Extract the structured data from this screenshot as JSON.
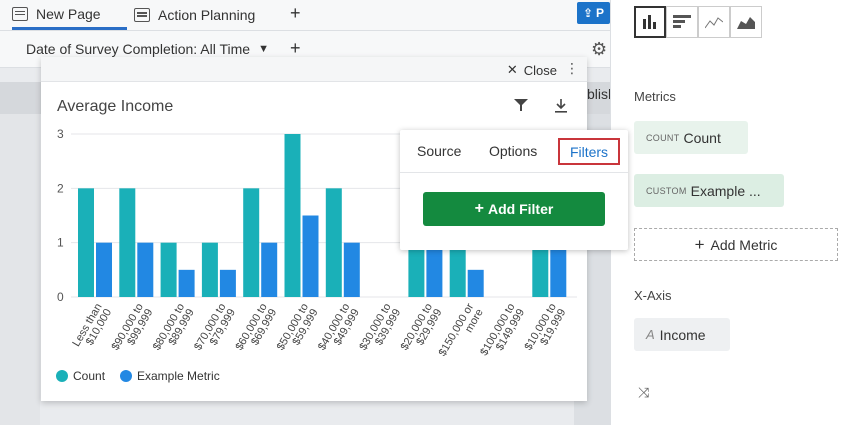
{
  "tabs": [
    {
      "label": "New Page",
      "active": true
    },
    {
      "label": "Action Planning",
      "active": false
    }
  ],
  "publish_label": "P",
  "filter_label": "Date of Survey Completion: All Time",
  "behind_text": "blish",
  "right_panel": {
    "metrics_label": "Metrics",
    "metrics": [
      {
        "prefix": "COUNT",
        "name": "Count"
      },
      {
        "prefix": "CUSTOM",
        "name": "Example ..."
      }
    ],
    "add_metric_label": "Add Metric",
    "xaxis_label": "X-Axis",
    "xaxis_value": "Income"
  },
  "modal": {
    "close_label": "Close",
    "title": "Average Income"
  },
  "popover": {
    "tabs": [
      "Source",
      "Options",
      "Filters"
    ],
    "active_tab": "Filters",
    "add_filter_label": "Add Filter"
  },
  "colors": {
    "count": "#1ab0b8",
    "example_metric": "#2288e3",
    "accent": "#1c73c9",
    "green": "#148a3f",
    "highlight": "#c9353b"
  },
  "chart_data": {
    "type": "bar",
    "title": "Average Income",
    "ylim": [
      0,
      3
    ],
    "yticks": [
      0,
      1,
      2,
      3
    ],
    "legend_position": "bottom-left",
    "categories": [
      "Less than $10,000",
      "$90,000 to $99,999",
      "$80,000 to $89,999",
      "$70,000 to $79,999",
      "$60,000 to $69,999",
      "$50,000 to $59,999",
      "$40,000 to $49,999",
      "$30,000 to $39,999",
      "$20,000 to $29,999",
      "$150,000 or more",
      "$100,000 to $149,999",
      "$10,000 to $19,999"
    ],
    "series": [
      {
        "name": "Count",
        "values": [
          2,
          2,
          1,
          1,
          2,
          3,
          2,
          0,
          1,
          1,
          0,
          1
        ]
      },
      {
        "name": "Example Metric",
        "values": [
          1,
          1,
          0.5,
          0.5,
          1,
          1.5,
          1,
          0,
          1,
          0.5,
          0,
          1
        ]
      }
    ]
  }
}
